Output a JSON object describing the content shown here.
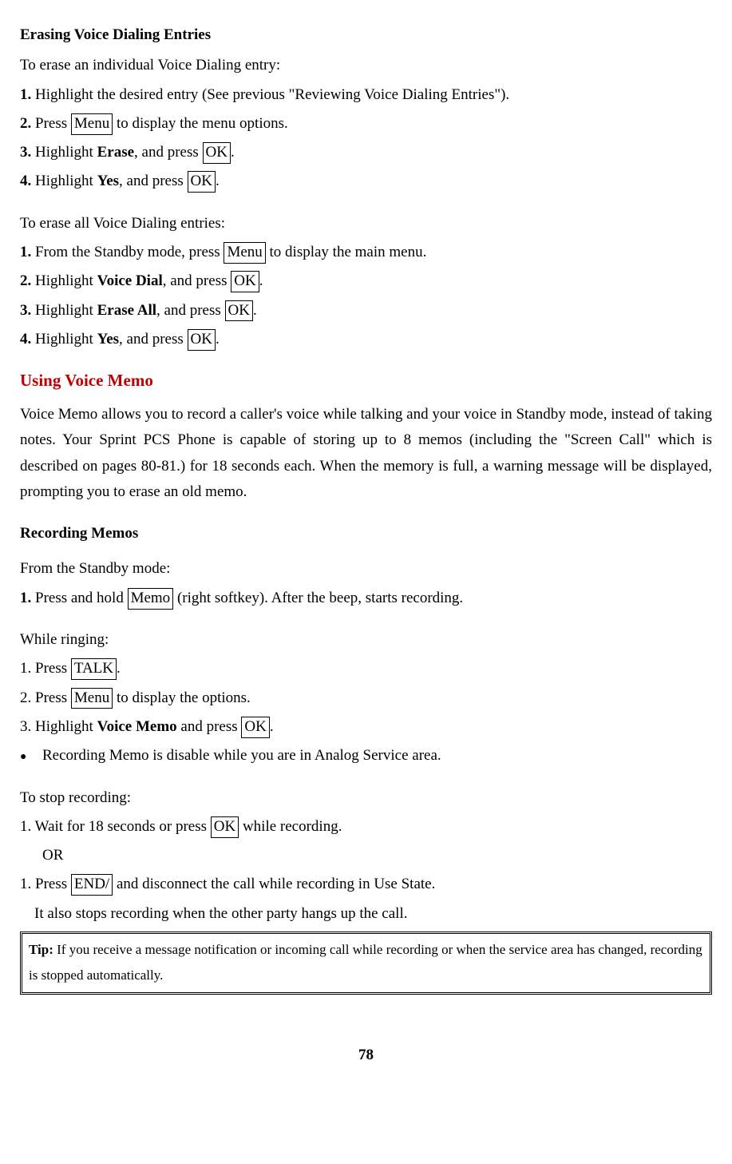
{
  "s1": {
    "title": "Erasing Voice Dialing Entries",
    "intro": "To erase an individual Voice Dialing entry:",
    "step1_num": "1.",
    "step1_text": " Highlight the desired entry (See previous \"Reviewing Voice Dialing Entries\").",
    "step2_num": "2.",
    "step2_a": " Press ",
    "step2_btn": "Menu",
    "step2_b": " to display the menu options.",
    "step3_num": "3.",
    "step3_a": " Highlight ",
    "step3_bold": "Erase",
    "step3_b": ", and press ",
    "step3_btn": "OK",
    "step3_c": ".",
    "step4_num": "4.",
    "step4_a": " Highlight ",
    "step4_bold": "Yes",
    "step4_b": ", and press ",
    "step4_btn": "OK",
    "step4_c": "."
  },
  "s2": {
    "intro": "To erase all Voice Dialing entries:",
    "step1_num": "1.",
    "step1_a": " From the Standby mode, press ",
    "step1_btn": "Menu",
    "step1_b": " to display the main menu.",
    "step2_num": "2.",
    "step2_a": " Highlight ",
    "step2_bold": "Voice Dial",
    "step2_b": ", and press ",
    "step2_btn": "OK",
    "step2_c": ".",
    "step3_num": "3.",
    "step3_a": " Highlight ",
    "step3_bold": "Erase All",
    "step3_b": ", and press ",
    "step3_btn": "OK",
    "step3_c": ".",
    "step4_num": "4.",
    "step4_a": " Highlight ",
    "step4_bold": "Yes",
    "step4_b": ", and press ",
    "step4_btn": "OK",
    "step4_c": "."
  },
  "voice_memo": {
    "heading": "Using Voice Memo",
    "para": "Voice Memo allows you to record a caller's voice while talking and your voice in Standby mode, instead of taking notes. Your Sprint PCS Phone is capable of storing up to 8 memos (including the \"Screen Call\" which is described on pages 80-81.) for 18 seconds each. When the memory is full, a warning message will be displayed, prompting you to erase an old memo."
  },
  "recording": {
    "heading": "Recording Memos",
    "standby_intro": "From the Standby mode:",
    "s_step1_num": "1.",
    "s_step1_a": " Press and hold ",
    "s_step1_btn": "Memo",
    "s_step1_b": " (right softkey). After the beep, starts recording.",
    "ringing_intro": "While ringing:",
    "r_step1_a": "1. Press ",
    "r_step1_btn": "TALK",
    "r_step1_b": ".",
    "r_step2_a": "2. Press ",
    "r_step2_btn": "Menu",
    "r_step2_b": " to display the options.",
    "r_step3_a": "3. Highlight ",
    "r_step3_bold": "Voice Memo",
    "r_step3_b": " and press ",
    "r_step3_btn": "OK",
    "r_step3_c": ".",
    "bullet": "Recording Memo is disable while you are in Analog Service area.",
    "stop_intro": "To stop recording:",
    "stop1_a": "1. Wait for 18 seconds or press ",
    "stop1_btn": "OK",
    "stop1_b": " while recording.",
    "or_text": "OR",
    "stop2_a": "1. Press ",
    "stop2_btn": "END/",
    "stop2_b": " and disconnect the call while recording in Use State.",
    "stop_note": "It also stops recording when the other party hangs up the call."
  },
  "tip": {
    "label": "Tip:",
    "text": " If you receive a message notification or incoming call while recording or when the service area has changed, recording is stopped automatically."
  },
  "page_num": "78"
}
